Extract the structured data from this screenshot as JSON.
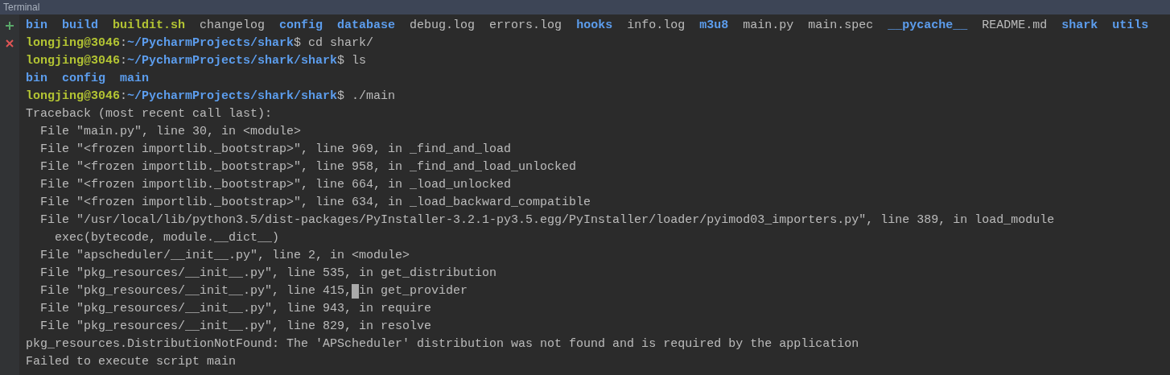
{
  "panel": {
    "title": "Terminal"
  },
  "lines": [
    {
      "kind": "listing",
      "segments": [
        {
          "text": "bin",
          "kind": "dir"
        },
        {
          "text": "build",
          "kind": "dir"
        },
        {
          "text": "buildit.sh",
          "kind": "exec"
        },
        {
          "text": "changelog",
          "kind": "plain"
        },
        {
          "text": "config",
          "kind": "dir"
        },
        {
          "text": "database",
          "kind": "dir"
        },
        {
          "text": "debug.log",
          "kind": "plain"
        },
        {
          "text": "errors.log",
          "kind": "plain"
        },
        {
          "text": "hooks",
          "kind": "dir"
        },
        {
          "text": "info.log",
          "kind": "plain"
        },
        {
          "text": "m3u8",
          "kind": "dir"
        },
        {
          "text": "main.py",
          "kind": "plain"
        },
        {
          "text": "main.spec",
          "kind": "plain"
        },
        {
          "text": "__pycache__",
          "kind": "dir"
        },
        {
          "text": "README.md",
          "kind": "plain"
        },
        {
          "text": "shark",
          "kind": "dir"
        },
        {
          "text": "utils",
          "kind": "dir"
        }
      ]
    },
    {
      "kind": "text",
      "segments": [
        {
          "text": "longjing@3046",
          "kind": "user"
        },
        {
          "text": ":",
          "kind": "plain"
        },
        {
          "text": "~/PycharmProjects/shark",
          "kind": "path"
        },
        {
          "text": "$ cd shark/",
          "kind": "plain"
        }
      ]
    },
    {
      "kind": "text",
      "segments": [
        {
          "text": "longjing@3046",
          "kind": "user"
        },
        {
          "text": ":",
          "kind": "plain"
        },
        {
          "text": "~/PycharmProjects/shark/shark",
          "kind": "path"
        },
        {
          "text": "$ ls",
          "kind": "plain"
        }
      ]
    },
    {
      "kind": "listing",
      "segments": [
        {
          "text": "bin",
          "kind": "dir"
        },
        {
          "text": "config",
          "kind": "dir"
        },
        {
          "text": "main",
          "kind": "dir"
        }
      ]
    },
    {
      "kind": "text",
      "segments": [
        {
          "text": "longjing@3046",
          "kind": "user"
        },
        {
          "text": ":",
          "kind": "plain"
        },
        {
          "text": "~/PycharmProjects/shark/shark",
          "kind": "path"
        },
        {
          "text": "$ ./main",
          "kind": "plain"
        }
      ]
    },
    {
      "kind": "text",
      "segments": [
        {
          "text": "Traceback (most recent call last):",
          "kind": "plain"
        }
      ]
    },
    {
      "kind": "text",
      "segments": [
        {
          "text": "  File \"main.py\", line 30, in <module>",
          "kind": "plain"
        }
      ]
    },
    {
      "kind": "text",
      "segments": [
        {
          "text": "  File \"<frozen importlib._bootstrap>\", line 969, in _find_and_load",
          "kind": "plain"
        }
      ]
    },
    {
      "kind": "text",
      "segments": [
        {
          "text": "  File \"<frozen importlib._bootstrap>\", line 958, in _find_and_load_unlocked",
          "kind": "plain"
        }
      ]
    },
    {
      "kind": "text",
      "segments": [
        {
          "text": "  File \"<frozen importlib._bootstrap>\", line 664, in _load_unlocked",
          "kind": "plain"
        }
      ]
    },
    {
      "kind": "text",
      "segments": [
        {
          "text": "  File \"<frozen importlib._bootstrap>\", line 634, in _load_backward_compatible",
          "kind": "plain"
        }
      ]
    },
    {
      "kind": "text",
      "segments": [
        {
          "text": "  File \"/usr/local/lib/python3.5/dist-packages/PyInstaller-3.2.1-py3.5.egg/PyInstaller/loader/pyimod03_importers.py\", line 389, in load_module",
          "kind": "plain"
        }
      ]
    },
    {
      "kind": "text",
      "segments": [
        {
          "text": "    exec(bytecode, module.__dict__)",
          "kind": "plain"
        }
      ]
    },
    {
      "kind": "text",
      "segments": [
        {
          "text": "  File \"apscheduler/__init__.py\", line 2, in <module>",
          "kind": "plain"
        }
      ]
    },
    {
      "kind": "text",
      "segments": [
        {
          "text": "  File \"pkg_resources/__init__.py\", line 535, in get_distribution",
          "kind": "plain"
        }
      ]
    },
    {
      "kind": "text",
      "segments": [
        {
          "text": "  File \"pkg_resources/__init__.py\", line 415,",
          "kind": "plain"
        },
        {
          "kind": "cursor"
        },
        {
          "text": "in get_provider",
          "kind": "plain"
        }
      ]
    },
    {
      "kind": "text",
      "segments": [
        {
          "text": "  File \"pkg_resources/__init__.py\", line 943, in require",
          "kind": "plain"
        }
      ]
    },
    {
      "kind": "text",
      "segments": [
        {
          "text": "  File \"pkg_resources/__init__.py\", line 829, in resolve",
          "kind": "plain"
        }
      ]
    },
    {
      "kind": "text",
      "segments": [
        {
          "text": "pkg_resources.DistributionNotFound: The 'APScheduler' distribution was not found and is required by the application",
          "kind": "plain"
        }
      ]
    },
    {
      "kind": "text",
      "segments": [
        {
          "text": "Failed to execute script main",
          "kind": "plain"
        }
      ]
    }
  ]
}
